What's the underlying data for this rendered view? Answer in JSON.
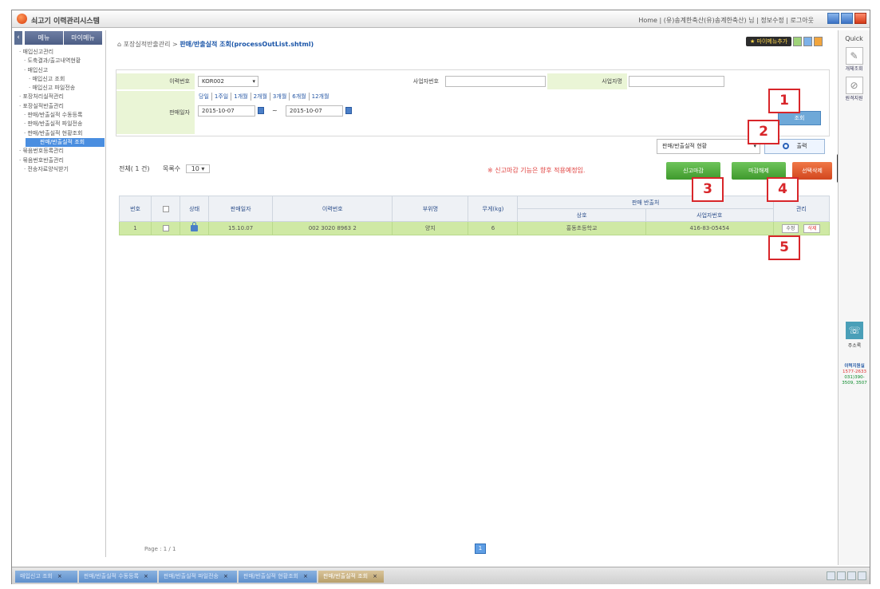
{
  "app": {
    "title": "쇠고기 이력관리시스템",
    "top_links": "Home | (유)송계한축산(유)송계한축산) 님 | 정보수정 | 로그아웃"
  },
  "sidebar": {
    "collapse_icon": "‹",
    "tabs": [
      "메뉴",
      "마이메뉴"
    ],
    "items": [
      {
        "label": "매입신고관리",
        "level": 1
      },
      {
        "label": "도축결과/출고내역현황",
        "level": 2
      },
      {
        "label": "매입신고",
        "level": 2
      },
      {
        "label": "매입신고 조회",
        "level": 3
      },
      {
        "label": "매입신고 파일전송",
        "level": 3
      },
      {
        "label": "포장처리실적관리",
        "level": 1
      },
      {
        "label": "포장실적반출관리",
        "level": 1
      },
      {
        "label": "판매/반출실적 수동등록",
        "level": 2
      },
      {
        "label": "판매/반출실적 파일전송",
        "level": 2
      },
      {
        "label": "판매/반출실적 현황조회",
        "level": 2
      },
      {
        "label": "판매/반출실적 조회",
        "level": 3,
        "active": true
      },
      {
        "label": "묶음번호등록관리",
        "level": 1
      },
      {
        "label": "묶음번호반출관리",
        "level": 1
      },
      {
        "label": "전송자료양식받기",
        "level": 2
      }
    ]
  },
  "breadcrumb": {
    "prefix": "포장실적반출관리 >",
    "current": "판매/반출실적 조회(processOutList.shtml)"
  },
  "top_buttons": {
    "favorite": "마이메뉴추가"
  },
  "search": {
    "trace_no_label": "이력번호",
    "trace_no_value": "KOR002",
    "biz_no_label": "사업자번호",
    "biz_name_label": "사업자명",
    "periods": [
      "당일",
      "1주일",
      "1개월",
      "2개월",
      "3개월",
      "6개월",
      "12개월"
    ],
    "sale_date_label": "판매일자",
    "date_from": "2015-10-07",
    "date_to": "2015-10-07",
    "date_sep": "~",
    "search_button": "조회"
  },
  "keyword": {
    "select_value": "판매/반출실적 현황",
    "button": "출력"
  },
  "list_info": {
    "total": "전체( 1 건)",
    "rows_label": "목록수",
    "rows_value": "10"
  },
  "notice": "※ 신고마감 기능은 향후 적용예정임.",
  "actions": {
    "close_report": "신고마감",
    "unclose": "마감해제",
    "delete_selected": "선택삭제"
  },
  "table": {
    "headers": [
      "번호",
      "",
      "상태",
      "판매일자",
      "이력번호",
      "부위명",
      "무게(kg)",
      "판매 반출처",
      "관리"
    ],
    "sub_headers": [
      "상호",
      "사업자번호"
    ],
    "rows": [
      {
        "no": "1",
        "date": "15.10.07",
        "trace": "002 3020 8963 2",
        "part": "양지",
        "weight": "6",
        "company": "홍동초등학교",
        "biz_no": "416-83-05454",
        "edit": "수정",
        "del": "삭제"
      }
    ]
  },
  "pagination": {
    "info": "Page : 1 / 1",
    "current": "1"
  },
  "callouts": [
    "1",
    "2",
    "3",
    "4",
    "5"
  ],
  "quick": {
    "title": "Quick",
    "items": [
      "개체조회",
      "원격지원"
    ],
    "phone_label": "주소록",
    "contact_title": "이력지원실",
    "contact_line1": "1577-2633",
    "contact_line2": "031)390-",
    "contact_line3": "3509, 3507"
  },
  "taskbar": {
    "tabs": [
      {
        "label": "매입신고 조회",
        "active": false
      },
      {
        "label": "판매/반출실적 수동등록",
        "active": false
      },
      {
        "label": "판매/반출실적 파일전송",
        "active": false
      },
      {
        "label": "판매/반출실적 현황조회",
        "active": false
      },
      {
        "label": "판매/반출실적 조회",
        "active": true
      }
    ],
    "close_glyph": "×"
  }
}
